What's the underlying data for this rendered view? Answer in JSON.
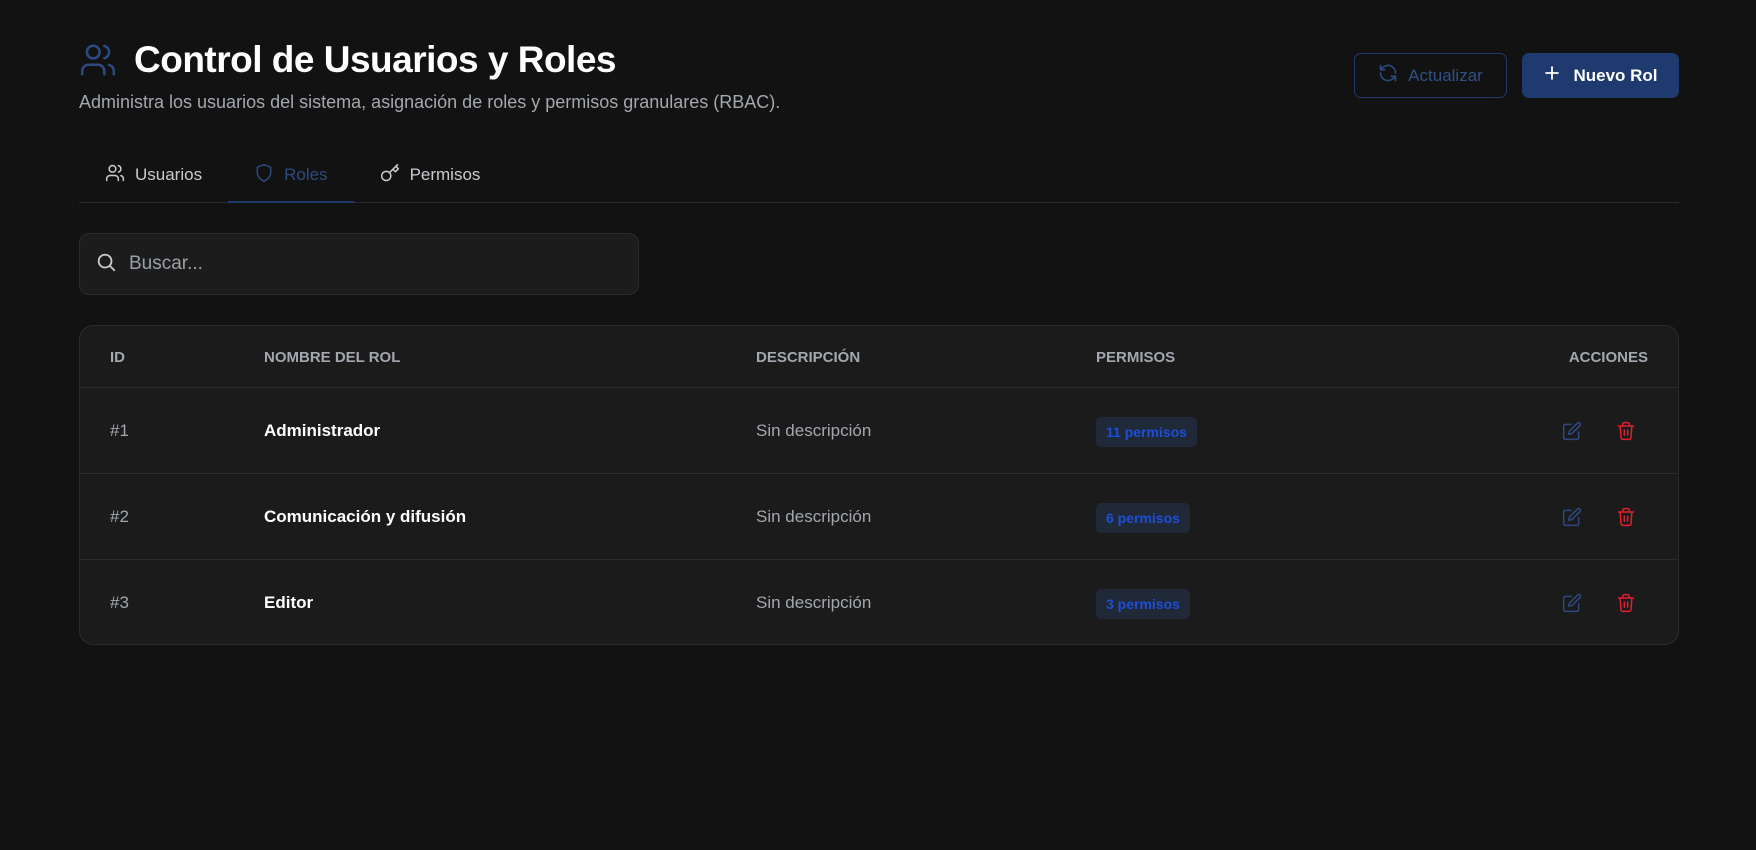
{
  "header": {
    "title": "Control de Usuarios y Roles",
    "subtitle": "Administra los usuarios del sistema, asignación de roles y permisos granulares (RBAC).",
    "title_icon": "users-icon",
    "refresh_label": "Actualizar",
    "refresh_icon": "refresh-icon",
    "new_label": "Nuevo Rol",
    "new_icon": "plus-icon"
  },
  "tabs": [
    {
      "label": "Usuarios",
      "icon": "users-icon",
      "active": false
    },
    {
      "label": "Roles",
      "icon": "shield-icon",
      "active": true
    },
    {
      "label": "Permisos",
      "icon": "key-icon",
      "active": false
    }
  ],
  "search": {
    "placeholder": "Buscar...",
    "value": "",
    "icon": "search-icon"
  },
  "table": {
    "columns": [
      "ID",
      "NOMBRE DEL ROL",
      "DESCRIPCIÓN",
      "PERMISOS",
      "ACCIONES"
    ],
    "rows": [
      {
        "id": "#1",
        "name": "Administrador",
        "description": "Sin descripción",
        "permissions": "11 permisos"
      },
      {
        "id": "#2",
        "name": "Comunicación y difusión",
        "description": "Sin descripción",
        "permissions": "6 permisos"
      },
      {
        "id": "#3",
        "name": "Editor",
        "description": "Sin descripción",
        "permissions": "3 permisos"
      }
    ],
    "actions": {
      "edit_icon": "edit-icon",
      "delete_icon": "trash-icon"
    }
  },
  "colors": {
    "background": "#121212",
    "accent": "#1e3a6e",
    "badge_text": "#1d4ed8",
    "delete": "#e11d2e"
  }
}
